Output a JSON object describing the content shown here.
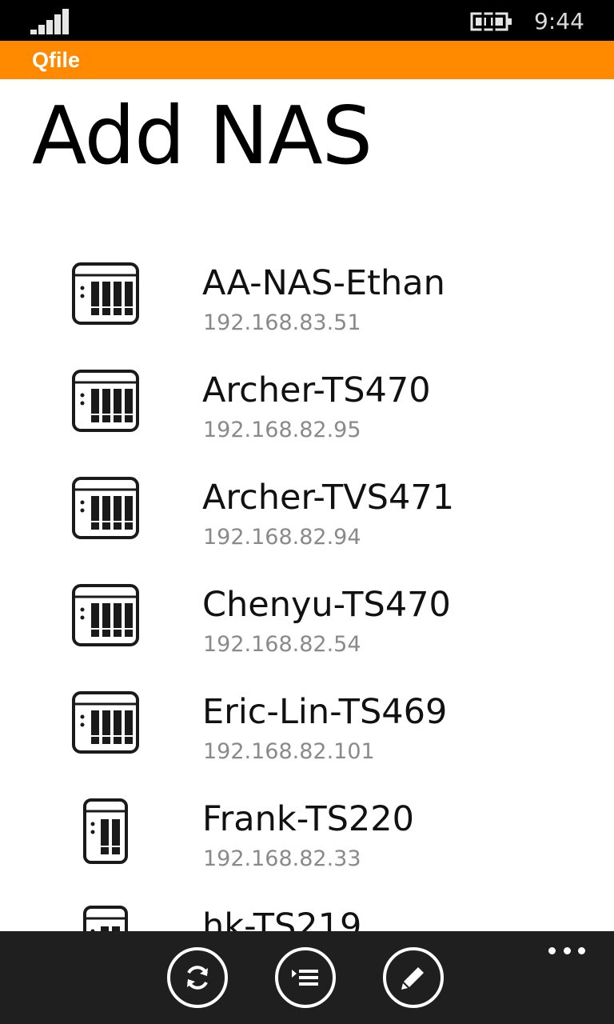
{
  "status_bar": {
    "time": "9:44",
    "signal_icon": "signal-strength-icon",
    "battery_icon": "battery-charging-icon"
  },
  "app_bar": {
    "app_name": "Qfile"
  },
  "page": {
    "title": "Add NAS"
  },
  "nas_list": {
    "items": [
      {
        "name": "AA-NAS-Ethan",
        "ip": "192.168.83.51",
        "icon": "nas-4-bay-icon"
      },
      {
        "name": "Archer-TS470",
        "ip": "192.168.82.95",
        "icon": "nas-4-bay-icon"
      },
      {
        "name": "Archer-TVS471",
        "ip": "192.168.82.94",
        "icon": "nas-4-bay-icon"
      },
      {
        "name": "Chenyu-TS470",
        "ip": "192.168.82.54",
        "icon": "nas-4-bay-icon"
      },
      {
        "name": "Eric-Lin-TS469",
        "ip": "192.168.82.101",
        "icon": "nas-4-bay-icon"
      },
      {
        "name": "Frank-TS220",
        "ip": "192.168.82.33",
        "icon": "nas-2-bay-icon"
      },
      {
        "name": "hk-TS219",
        "ip": "",
        "icon": "nas-2-bay-icon"
      }
    ]
  },
  "bottom_bar": {
    "buttons": [
      {
        "icon": "refresh-icon"
      },
      {
        "icon": "select-list-icon"
      },
      {
        "icon": "edit-pencil-icon"
      }
    ],
    "more_icon": "more-ellipsis-icon"
  }
}
